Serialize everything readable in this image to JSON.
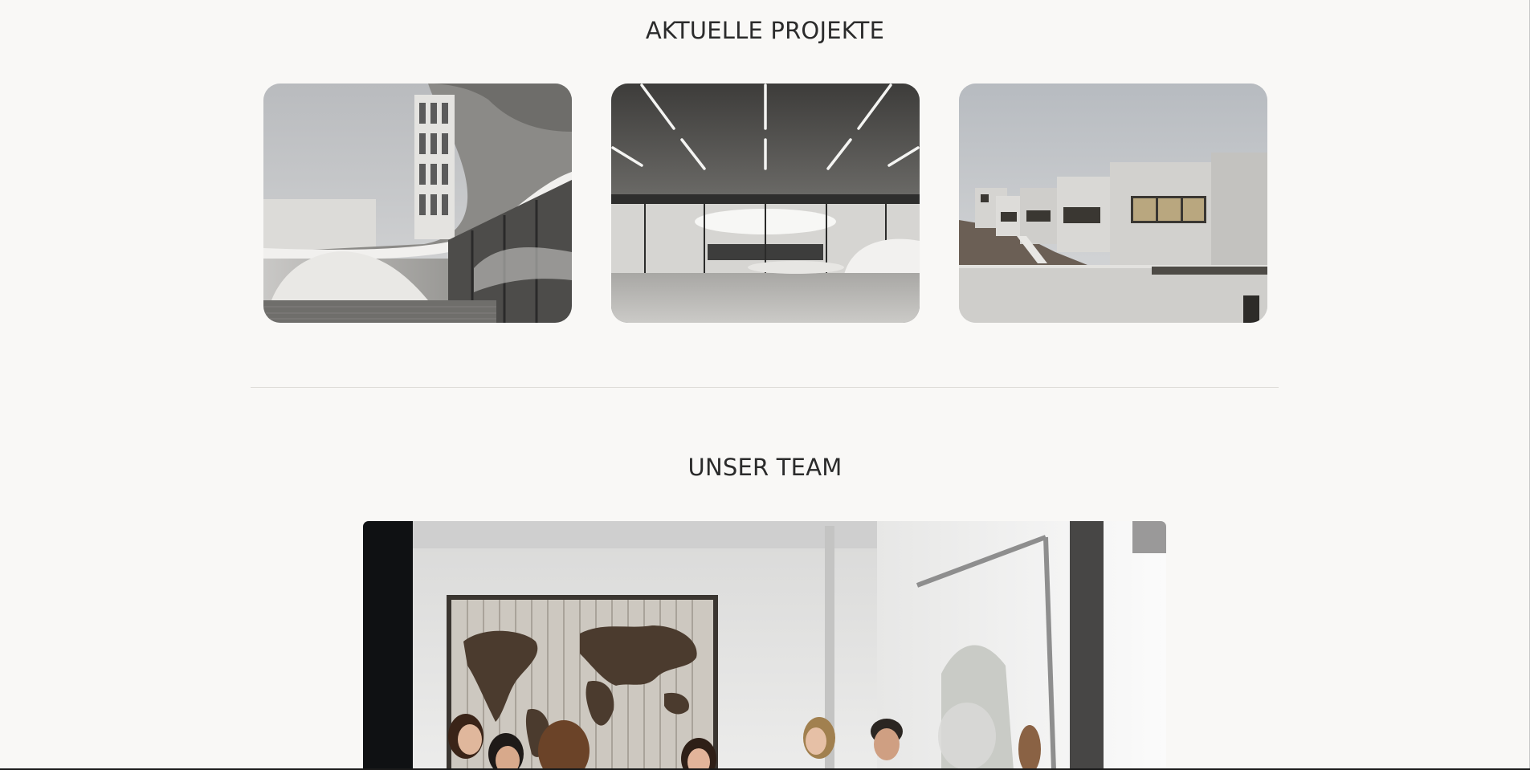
{
  "projects": {
    "title": "AKTUELLE PROJEKTE",
    "items": [
      {
        "image_icon": "curved-concrete-building-image"
      },
      {
        "image_icon": "concrete-hall-interior-image"
      },
      {
        "image_icon": "terraced-concrete-houses-image"
      }
    ]
  },
  "team": {
    "title": "UNSER TEAM",
    "image_icon": "team-meeting-photo"
  },
  "colors": {
    "background": "#f9f8f6",
    "heading": "#2b2b2b",
    "divider": "#dedcd8"
  }
}
